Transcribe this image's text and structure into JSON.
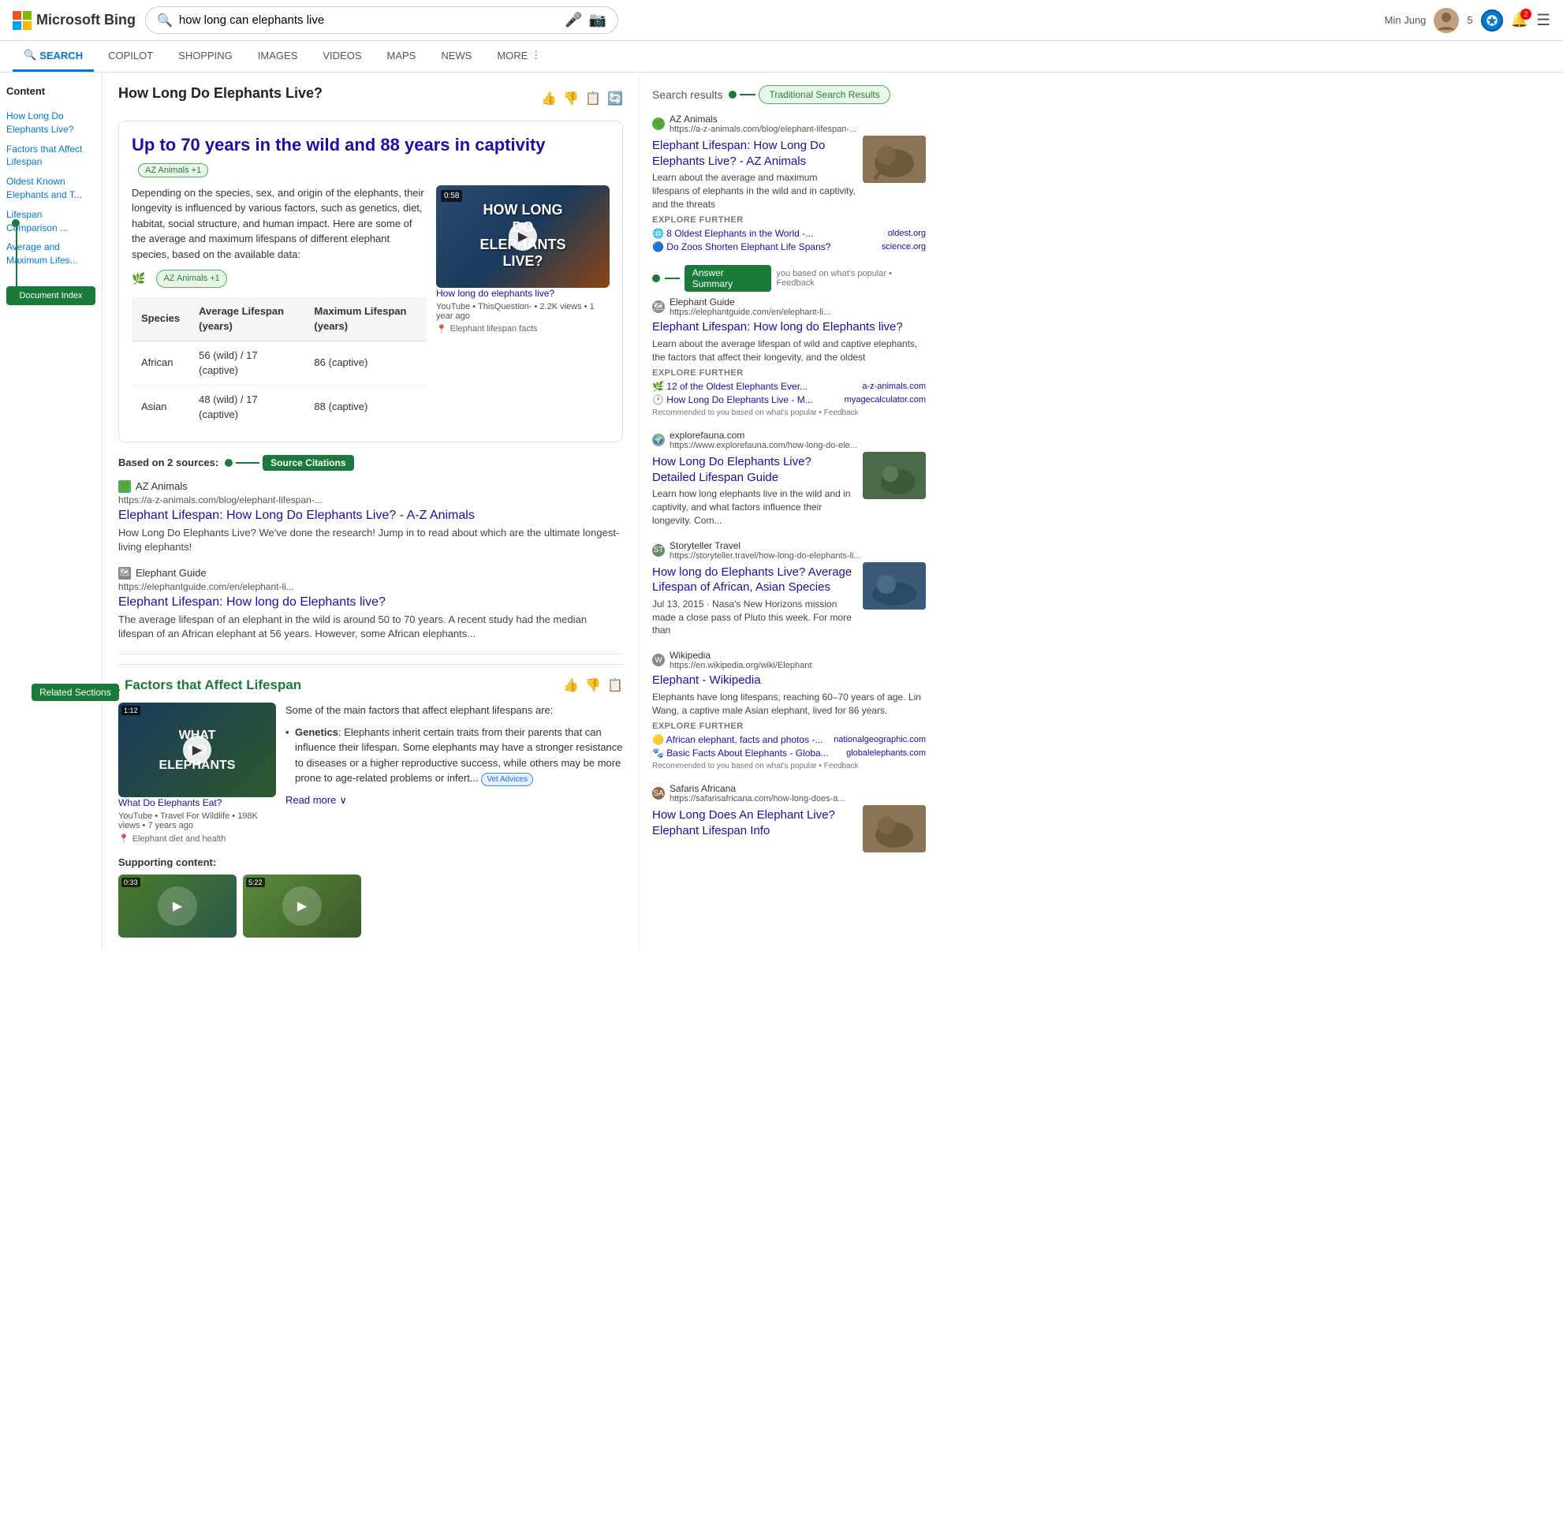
{
  "header": {
    "logo": "Microsoft Bing",
    "search_query": "how long can elephants live",
    "user_name": "Min Jung",
    "badge_number": "5"
  },
  "nav": {
    "items": [
      {
        "label": "SEARCH",
        "active": true,
        "icon": "🔍"
      },
      {
        "label": "COPILOT",
        "active": false
      },
      {
        "label": "SHOPPING",
        "active": false
      },
      {
        "label": "IMAGES",
        "active": false
      },
      {
        "label": "VIDEOS",
        "active": false
      },
      {
        "label": "MAPS",
        "active": false
      },
      {
        "label": "NEWS",
        "active": false
      },
      {
        "label": "MORE",
        "active": false
      }
    ]
  },
  "sidebar": {
    "title": "Content",
    "items": [
      {
        "label": "How Long Do Elephants Live?"
      },
      {
        "label": "Factors that Affect Lifespan"
      },
      {
        "label": "Oldest Known Elephants and T..."
      },
      {
        "label": "Lifespan Comparison ..."
      },
      {
        "label": "Average and Maximum Lifes..."
      }
    ],
    "doc_index_label": "Document Index",
    "related_sections_label": "Related Sections"
  },
  "main": {
    "result_title": "How Long Do Elephants Live?",
    "answer": {
      "headline": "Up to 70 years in the wild and 88 years in captivity",
      "source_badge": "AZ Animals +1",
      "body_text": "Depending on the species, sex, and origin of the elephants, their longevity is influenced by various factors, such as genetics, diet, habitat, social structure, and human impact. Here are some of the average and maximum lifespans of different elephant species, based on the available data:",
      "source_label": "AZ Animals +1",
      "location_hint": "Elephant lifespan facts",
      "video": {
        "duration": "0:58",
        "title": "How long do elephants live?",
        "text_lines": [
          "HOW LONG",
          "DO",
          "ELEPHANTS",
          "LIVE?"
        ],
        "meta": "YouTube • ThisQuestion- • 2.2K views • 1 year ago"
      },
      "table": {
        "headers": [
          "Species",
          "Average Lifespan (years)",
          "Maximum Lifespan (years)"
        ],
        "rows": [
          [
            "African",
            "56 (wild) / 17 (captive)",
            "86 (captive)"
          ],
          [
            "Asian",
            "48 (wild) / 17 (captive)",
            "88 (captive)"
          ]
        ]
      }
    },
    "sources_section": {
      "label": "Based on 2 sources:",
      "badge_label": "Source Citations",
      "citations": [
        {
          "site_name": "AZ Animals",
          "url": "https://a-z-animals.com/blog/elephant-lifespan-...",
          "title": "Elephant Lifespan: How Long Do Elephants Live? - A-Z Animals",
          "snippet": "How Long Do Elephants Live? We've done the research! Jump in to read about which are the ultimate longest-living elephants!"
        },
        {
          "site_name": "Elephant Guide",
          "url": "https://elephantguide.com/en/elephant-li...",
          "title": "Elephant Lifespan: How long do Elephants live?",
          "snippet": "The average lifespan of an elephant in the wild is around 50 to 70 years. A recent study had the median lifespan of an African elephant at 56 years. However, some African elephants..."
        }
      ]
    },
    "factors_section": {
      "title": "Factors that Affect Lifespan",
      "video": {
        "duration": "1:12",
        "text_lines": [
          "WHAT",
          "DO",
          "ELEPHANTS"
        ],
        "title_below": "What Do Elephants Eat?",
        "meta": "YouTube • Travel For Wildlife • 198K views • 7 years ago",
        "location": "Elephant diet and health"
      },
      "intro": "Some of the main factors that affect elephant lifespans are:",
      "list_items": [
        {
          "term": "Genetics",
          "text": "Elephants inherit certain traits from their parents that can influence their lifespan. Some elephants may have a stronger resistance to diseases or a higher reproductive success, while others may be more prone to age-related problems or infert..."
        }
      ],
      "vet_badge": "Vet Advices",
      "read_more": "Read more"
    },
    "supporting": {
      "label": "Supporting content:",
      "thumbs": [
        {
          "duration": "0:33"
        },
        {
          "duration": "5:22"
        }
      ]
    }
  },
  "right_panel": {
    "search_results_label": "Search results",
    "traditional_badge": "Traditional Search Results",
    "answer_summary_label": "Answer Summary",
    "results": [
      {
        "site_name": "AZ Animals",
        "url": "https://a-z-animals.com/blog/elephant-lifespan-...",
        "title": "Elephant Lifespan: How Long Do Elephants Live? - AZ Animals",
        "snippet": "Learn about the average and maximum lifespans of elephants in the wild and in captivity, and the threats",
        "has_thumb": true,
        "thumb_style": "elephant-thumb",
        "explore_further": true,
        "explore_links": [
          {
            "text": "8 Oldest Elephants in the World -...",
            "domain": "oldest.org",
            "icon": "🌐"
          },
          {
            "text": "Do Zoos Shorten Elephant Life Spans?",
            "domain": "science.org",
            "icon": "🔵"
          }
        ]
      },
      {
        "site_name": "Elephant Guide",
        "url": "https://elephantguide.com/en/elephant-li...",
        "title": "Elephant Lifespan: How long do Elephants live?",
        "snippet": "Learn about the average lifespan of wild and captive elephants, the factors that affect their longevity, and the oldest",
        "has_thumb": false,
        "explore_further": true,
        "explore_links": [
          {
            "text": "12 of the Oldest Elephants Ever...",
            "domain": "a-z-animals.com",
            "icon": "🌿"
          },
          {
            "text": "How Long Do Elephants Live - M...",
            "domain": "myagecalculator.com",
            "icon": "🕐"
          }
        ],
        "recommended": "Recommended to you based on what's popular • Feedback"
      },
      {
        "site_name": "explorefauna.com",
        "url": "https://www.explorefauna.com/how-long-do-ele...",
        "title": "How Long Do Elephants Live? Detailed Lifespan Guide",
        "snippet": "Learn how long elephants live in the wild and in captivity, and what factors influence their longevity. Com...",
        "has_thumb": true,
        "thumb_style": "elephant-thumb2"
      },
      {
        "site_name": "Storyteller Travel",
        "url": "https://storyteller.travel/how-long-do-elephants-li...",
        "title": "How long do Elephants Live? Average Lifespan of African, Asian Species",
        "snippet": "Jul 13, 2015 · Nasa's New Horizons mission made a close pass of Pluto this week. For more than",
        "has_thumb": true,
        "thumb_style": "elephant-thumb3"
      },
      {
        "site_name": "Wikipedia",
        "url": "https://en.wikipedia.org/wiki/Elephant",
        "title": "Elephant - Wikipedia",
        "snippet": "Elephants have long lifespans, reaching 60–70 years of age. Lin Wang, a captive male Asian elephant, lived for 86 years.",
        "has_thumb": false,
        "explore_further": true,
        "explore_links": [
          {
            "text": "African elephant, facts and photos -...",
            "domain": "nationalgeographic.com",
            "icon": "🟡"
          },
          {
            "text": "Basic Facts About Elephants - Globa...",
            "domain": "globalelephants.com",
            "icon": "🐾"
          }
        ],
        "recommended": "Recommended to you based on what's popular • Feedback"
      },
      {
        "site_name": "Safaris Africana",
        "url": "https://safarisafricana.com/how-long-does-a...",
        "title": "How Long Does An Elephant Live? Elephant Lifespan Info",
        "snippet": "",
        "has_thumb": true,
        "thumb_style": "elephant-thumb"
      }
    ]
  }
}
